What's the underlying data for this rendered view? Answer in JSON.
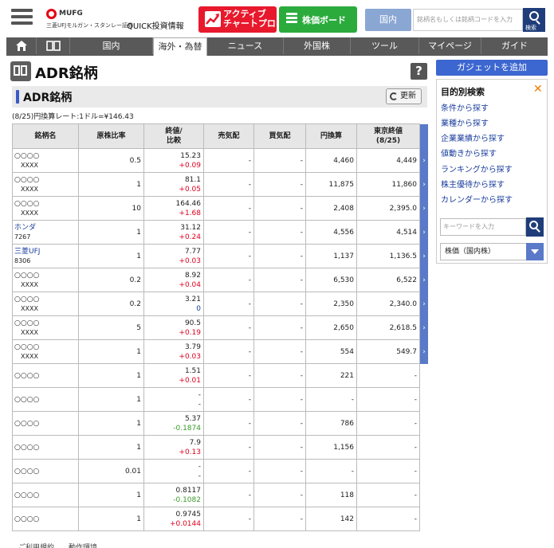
{
  "header": {
    "logo_mufg": "MUFG",
    "logo_sub": "三菱UFJモルガン・スタンレー証券",
    "logo_quick": "QUICK投資情報",
    "active_chart_label_1": "アクティブ",
    "active_chart_label_2": "チャートプロ",
    "board_label": "株価ボード",
    "region_label": "国内",
    "search_placeholder": "銘柄名もしくは銘柄コードを入力",
    "search_button_label": "検索"
  },
  "nav": {
    "tabs": [
      "国内",
      "海外・為替",
      "ニュース",
      "外国株",
      "ツール",
      "マイページ",
      "ガイド"
    ],
    "active_tab": "海外・為替"
  },
  "page": {
    "title": "ADR銘柄",
    "section_title": "ADR銘柄",
    "refresh_label": "更新",
    "rate_note": "(8/25)円換算レート:1ドル=¥146.43",
    "help_label": "?"
  },
  "table": {
    "headers": {
      "name": "銘柄名",
      "ratio": "原株比率",
      "close_1": "終値/",
      "close_2": "比較",
      "bid": "売気配",
      "ask": "買気配",
      "yen": "円換算",
      "tokyo_1": "東京終値",
      "tokyo_2": "(8/25)"
    },
    "rows": [
      {
        "name": "○○○○",
        "code": "XXXX",
        "link": false,
        "ratio": "0.5",
        "price": "15.23",
        "change": "+0.09",
        "dir": "up",
        "bid": "-",
        "ask": "-",
        "yen": "4,460",
        "tokyo": "4,449",
        "arrow": true
      },
      {
        "name": "○○○○",
        "code": "XXXX",
        "link": false,
        "ratio": "1",
        "price": "81.1",
        "change": "+0.05",
        "dir": "up",
        "bid": "-",
        "ask": "-",
        "yen": "11,875",
        "tokyo": "11,860",
        "arrow": true
      },
      {
        "name": "○○○○",
        "code": "XXXX",
        "link": false,
        "ratio": "10",
        "price": "164.46",
        "change": "+1.68",
        "dir": "up",
        "bid": "-",
        "ask": "-",
        "yen": "2,408",
        "tokyo": "2,395.0",
        "arrow": true
      },
      {
        "name": "ホンダ",
        "code": "7267",
        "link": true,
        "ratio": "1",
        "price": "31.12",
        "change": "+0.24",
        "dir": "up",
        "bid": "-",
        "ask": "-",
        "yen": "4,556",
        "tokyo": "4,514",
        "arrow": true
      },
      {
        "name": "三菱UFJ",
        "code": "8306",
        "link": true,
        "ratio": "1",
        "price": "7.77",
        "change": "+0.03",
        "dir": "up",
        "bid": "-",
        "ask": "-",
        "yen": "1,137",
        "tokyo": "1,136.5",
        "arrow": true
      },
      {
        "name": "○○○○",
        "code": "XXXX",
        "link": false,
        "ratio": "0.2",
        "price": "8.92",
        "change": "+0.04",
        "dir": "up",
        "bid": "-",
        "ask": "-",
        "yen": "6,530",
        "tokyo": "6,522",
        "arrow": true
      },
      {
        "name": "○○○○",
        "code": "XXXX",
        "link": false,
        "ratio": "0.2",
        "price": "3.21",
        "change": "0",
        "dir": "flat",
        "bid": "-",
        "ask": "-",
        "yen": "2,350",
        "tokyo": "2,340.0",
        "arrow": true
      },
      {
        "name": "○○○○",
        "code": "XXXX",
        "link": false,
        "ratio": "5",
        "price": "90.5",
        "change": "+0.19",
        "dir": "up",
        "bid": "-",
        "ask": "-",
        "yen": "2,650",
        "tokyo": "2,618.5",
        "arrow": true
      },
      {
        "name": "○○○○",
        "code": "XXXX",
        "link": false,
        "ratio": "1",
        "price": "3.79",
        "change": "+0.03",
        "dir": "up",
        "bid": "-",
        "ask": "-",
        "yen": "554",
        "tokyo": "549.7",
        "arrow": true
      },
      {
        "name": "○○○○",
        "code": "",
        "link": false,
        "ratio": "1",
        "price": "1.51",
        "change": "+0.01",
        "dir": "up",
        "bid": "-",
        "ask": "-",
        "yen": "221",
        "tokyo": "-",
        "arrow": false
      },
      {
        "name": "○○○○",
        "code": "",
        "link": false,
        "ratio": "1",
        "price": "-",
        "change": "-",
        "dir": "none",
        "bid": "-",
        "ask": "-",
        "yen": "-",
        "tokyo": "-",
        "arrow": false
      },
      {
        "name": "○○○○",
        "code": "",
        "link": false,
        "ratio": "1",
        "price": "5.37",
        "change": "-0.1874",
        "dir": "down",
        "bid": "-",
        "ask": "-",
        "yen": "786",
        "tokyo": "-",
        "arrow": false
      },
      {
        "name": "○○○○",
        "code": "",
        "link": false,
        "ratio": "1",
        "price": "7.9",
        "change": "+0.13",
        "dir": "up",
        "bid": "-",
        "ask": "-",
        "yen": "1,156",
        "tokyo": "-",
        "arrow": false
      },
      {
        "name": "○○○○",
        "code": "",
        "link": false,
        "ratio": "0.01",
        "price": "-",
        "change": "-",
        "dir": "none",
        "bid": "-",
        "ask": "-",
        "yen": "-",
        "tokyo": "-",
        "arrow": false
      },
      {
        "name": "○○○○",
        "code": "",
        "link": false,
        "ratio": "1",
        "price": "0.8117",
        "change": "-0.1082",
        "dir": "down",
        "bid": "-",
        "ask": "-",
        "yen": "118",
        "tokyo": "-",
        "arrow": false
      },
      {
        "name": "○○○○",
        "code": "",
        "link": false,
        "ratio": "1",
        "price": "0.9745",
        "change": "+0.0144",
        "dir": "up",
        "bid": "-",
        "ask": "-",
        "yen": "142",
        "tokyo": "-",
        "arrow": false
      }
    ]
  },
  "footer": {
    "links_text": "ご利用規約　　動作環境"
  },
  "sidebar": {
    "gadget_label": "ガジェットを追加",
    "panel_title": "目的別検索",
    "close_label": "✕",
    "links": [
      "条件から探す",
      "業種から探す",
      "企業業績から探す",
      "値動きから探す",
      "ランキングから探す",
      "株主優待から探す",
      "カレンダーから探す"
    ],
    "keyword_placeholder": "キーワードを入力",
    "select_value": "株価（国内株）"
  },
  "colors": {
    "up": "#e0001e",
    "down": "#3a9a2a",
    "accent_blue": "#3c66d0",
    "nav_bg": "#595959"
  }
}
